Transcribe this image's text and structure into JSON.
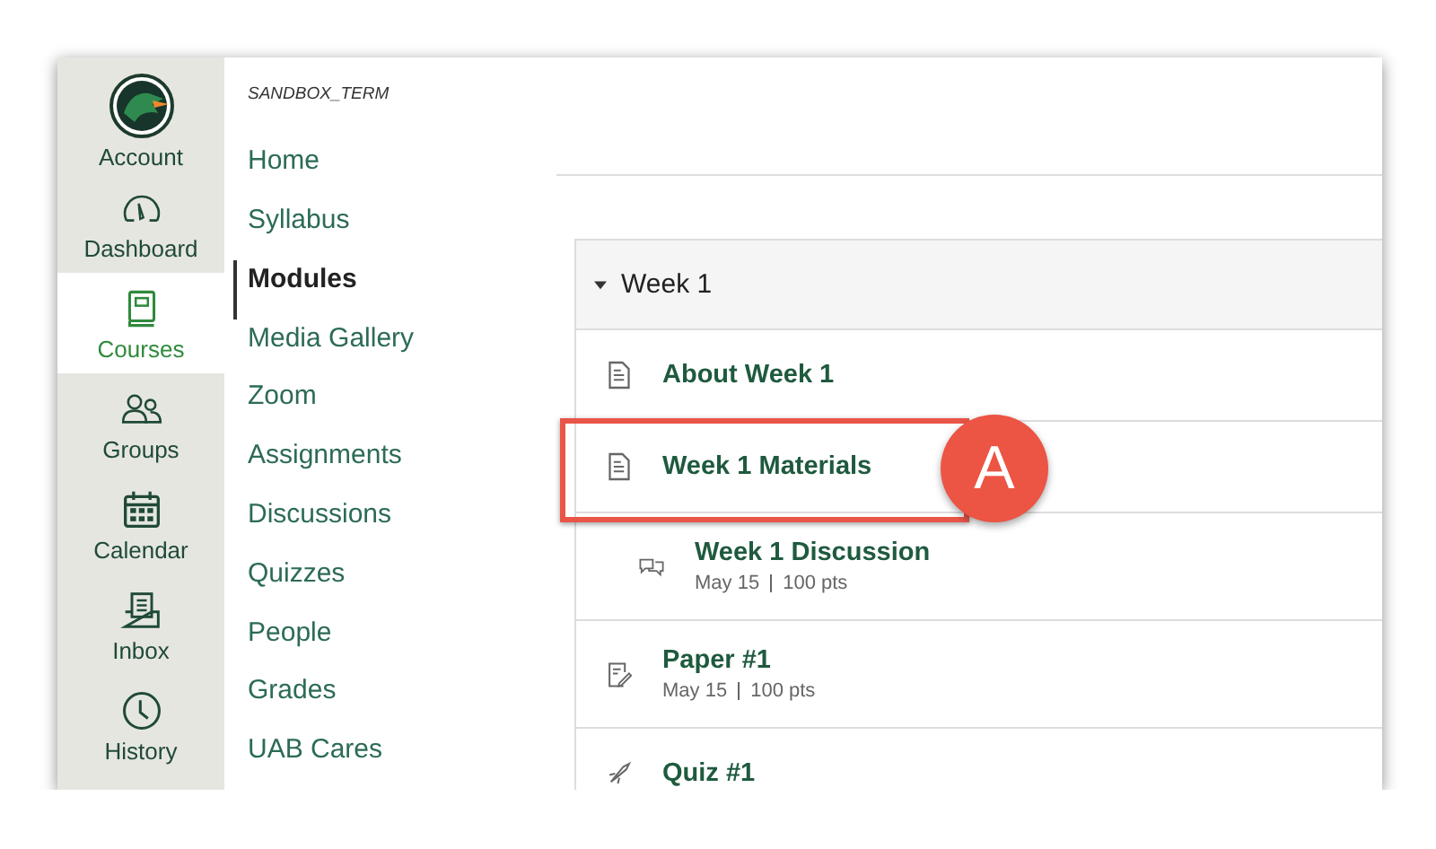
{
  "global_nav": [
    {
      "label": "Account",
      "kind": "avatar",
      "selected": false
    },
    {
      "label": "Dashboard",
      "kind": "gauge",
      "selected": false
    },
    {
      "label": "Courses",
      "kind": "book",
      "selected": true
    },
    {
      "label": "Groups",
      "kind": "people",
      "selected": false
    },
    {
      "label": "Calendar",
      "kind": "calendar",
      "selected": false
    },
    {
      "label": "Inbox",
      "kind": "inbox",
      "selected": false
    },
    {
      "label": "History",
      "kind": "clock",
      "selected": false
    }
  ],
  "course_nav": {
    "term": "SANDBOX_TERM",
    "items": [
      {
        "label": "Home",
        "selected": false
      },
      {
        "label": "Syllabus",
        "selected": false
      },
      {
        "label": "Modules",
        "selected": true
      },
      {
        "label": "Media Gallery",
        "selected": false
      },
      {
        "label": "Zoom",
        "selected": false
      },
      {
        "label": "Assignments",
        "selected": false
      },
      {
        "label": "Discussions",
        "selected": false
      },
      {
        "label": "Quizzes",
        "selected": false
      },
      {
        "label": "People",
        "selected": false
      },
      {
        "label": "Grades",
        "selected": false
      },
      {
        "label": "UAB Cares",
        "selected": false
      }
    ]
  },
  "module": {
    "title": "Week 1",
    "expanded": true,
    "items": [
      {
        "kind": "page",
        "title": "About Week 1",
        "indented": false
      },
      {
        "kind": "page",
        "title": "Week 1 Materials",
        "indented": false,
        "callout": "A"
      },
      {
        "kind": "discussion",
        "title": "Week 1 Discussion",
        "date": "May 15",
        "points": "100 pts",
        "indented": true
      },
      {
        "kind": "assignment",
        "title": "Paper #1",
        "date": "May 15",
        "points": "100 pts",
        "indented": false
      },
      {
        "kind": "quiz",
        "title": "Quiz #1",
        "indented": false
      }
    ]
  }
}
